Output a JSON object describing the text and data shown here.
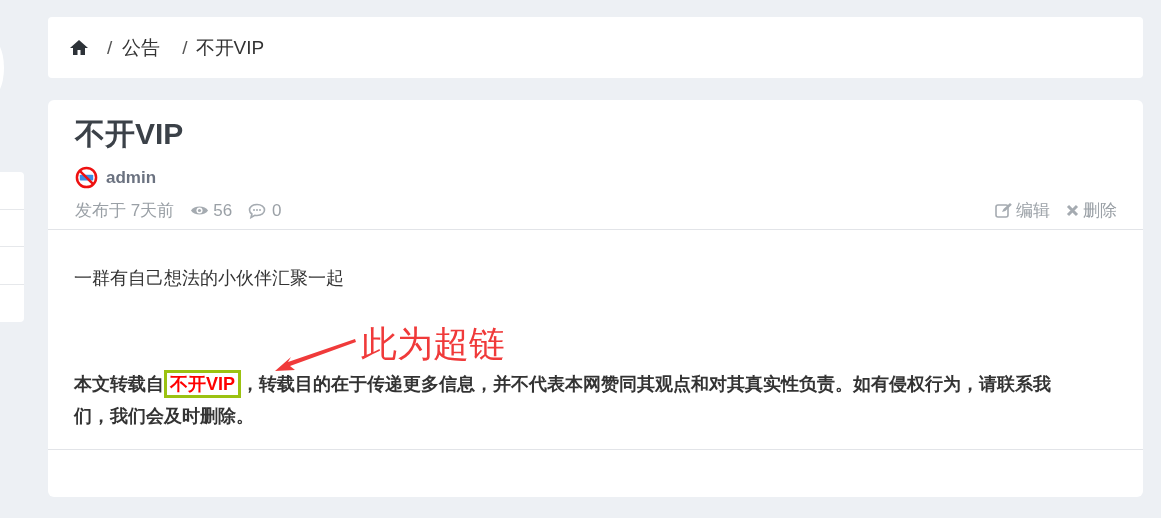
{
  "breadcrumb": [
    "公告",
    "不开VIP"
  ],
  "breadcrumb_separator": "/",
  "article": {
    "title": "不开VIP",
    "author": "admin",
    "published": "发布于 7天前",
    "views": "56",
    "comments": "0",
    "actions": [
      "编辑",
      "删除"
    ],
    "body": "一群有自己想法的小伙伴汇聚一起",
    "notice": {
      "before": "本文转载自",
      "link": "不开VIP",
      "after": "，转载目的在于传递更多信息，并不代表本网赞同其观点和对其真实性负责。如有侵权行为，请联系我们，我们会及时删除。"
    }
  },
  "annotation": {
    "text": "此为超链"
  }
}
